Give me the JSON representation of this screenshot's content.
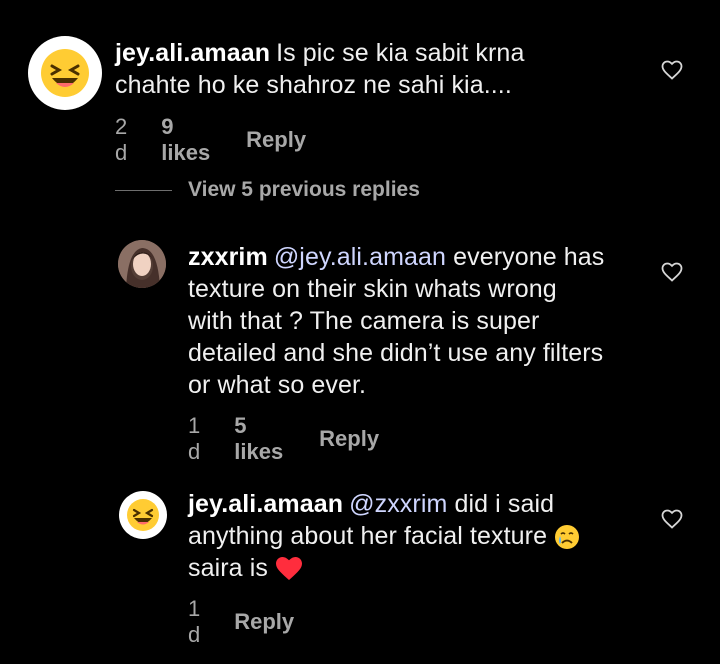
{
  "comments": [
    {
      "username": "jey.ali.amaan",
      "text_lines": [
        "Is pic se kia sabit krna",
        "chahte ho ke shahroz ne sahi kia...."
      ],
      "time": "2 d",
      "likes": "9 likes",
      "reply": "Reply"
    },
    {
      "username": "zxxrim",
      "mention": "@jey.ali.amaan",
      "text_line1": "everyone has",
      "text_lines_rest": [
        "texture on their skin whats wrong",
        "with that ? The camera is super",
        "detailed and she didn’t use any filters",
        "or what so ever."
      ],
      "time": "1 d",
      "likes": "5 likes",
      "reply": "Reply"
    },
    {
      "username": "jey.ali.amaan",
      "mention": "@zxxrim",
      "text_line1": "did i said",
      "text_line2": "anything about her facial texture",
      "text_line3": "saira is",
      "time": "1 d",
      "reply": "Reply"
    }
  ],
  "view_replies": "View 5 previous replies",
  "colors": {
    "background": "#000000",
    "meta": "#a8a8a8",
    "heart": "#ff2d3d"
  },
  "icons": [
    "heart-icon",
    "laughing-emoji",
    "crying-emoji",
    "red-heart-emoji"
  ]
}
